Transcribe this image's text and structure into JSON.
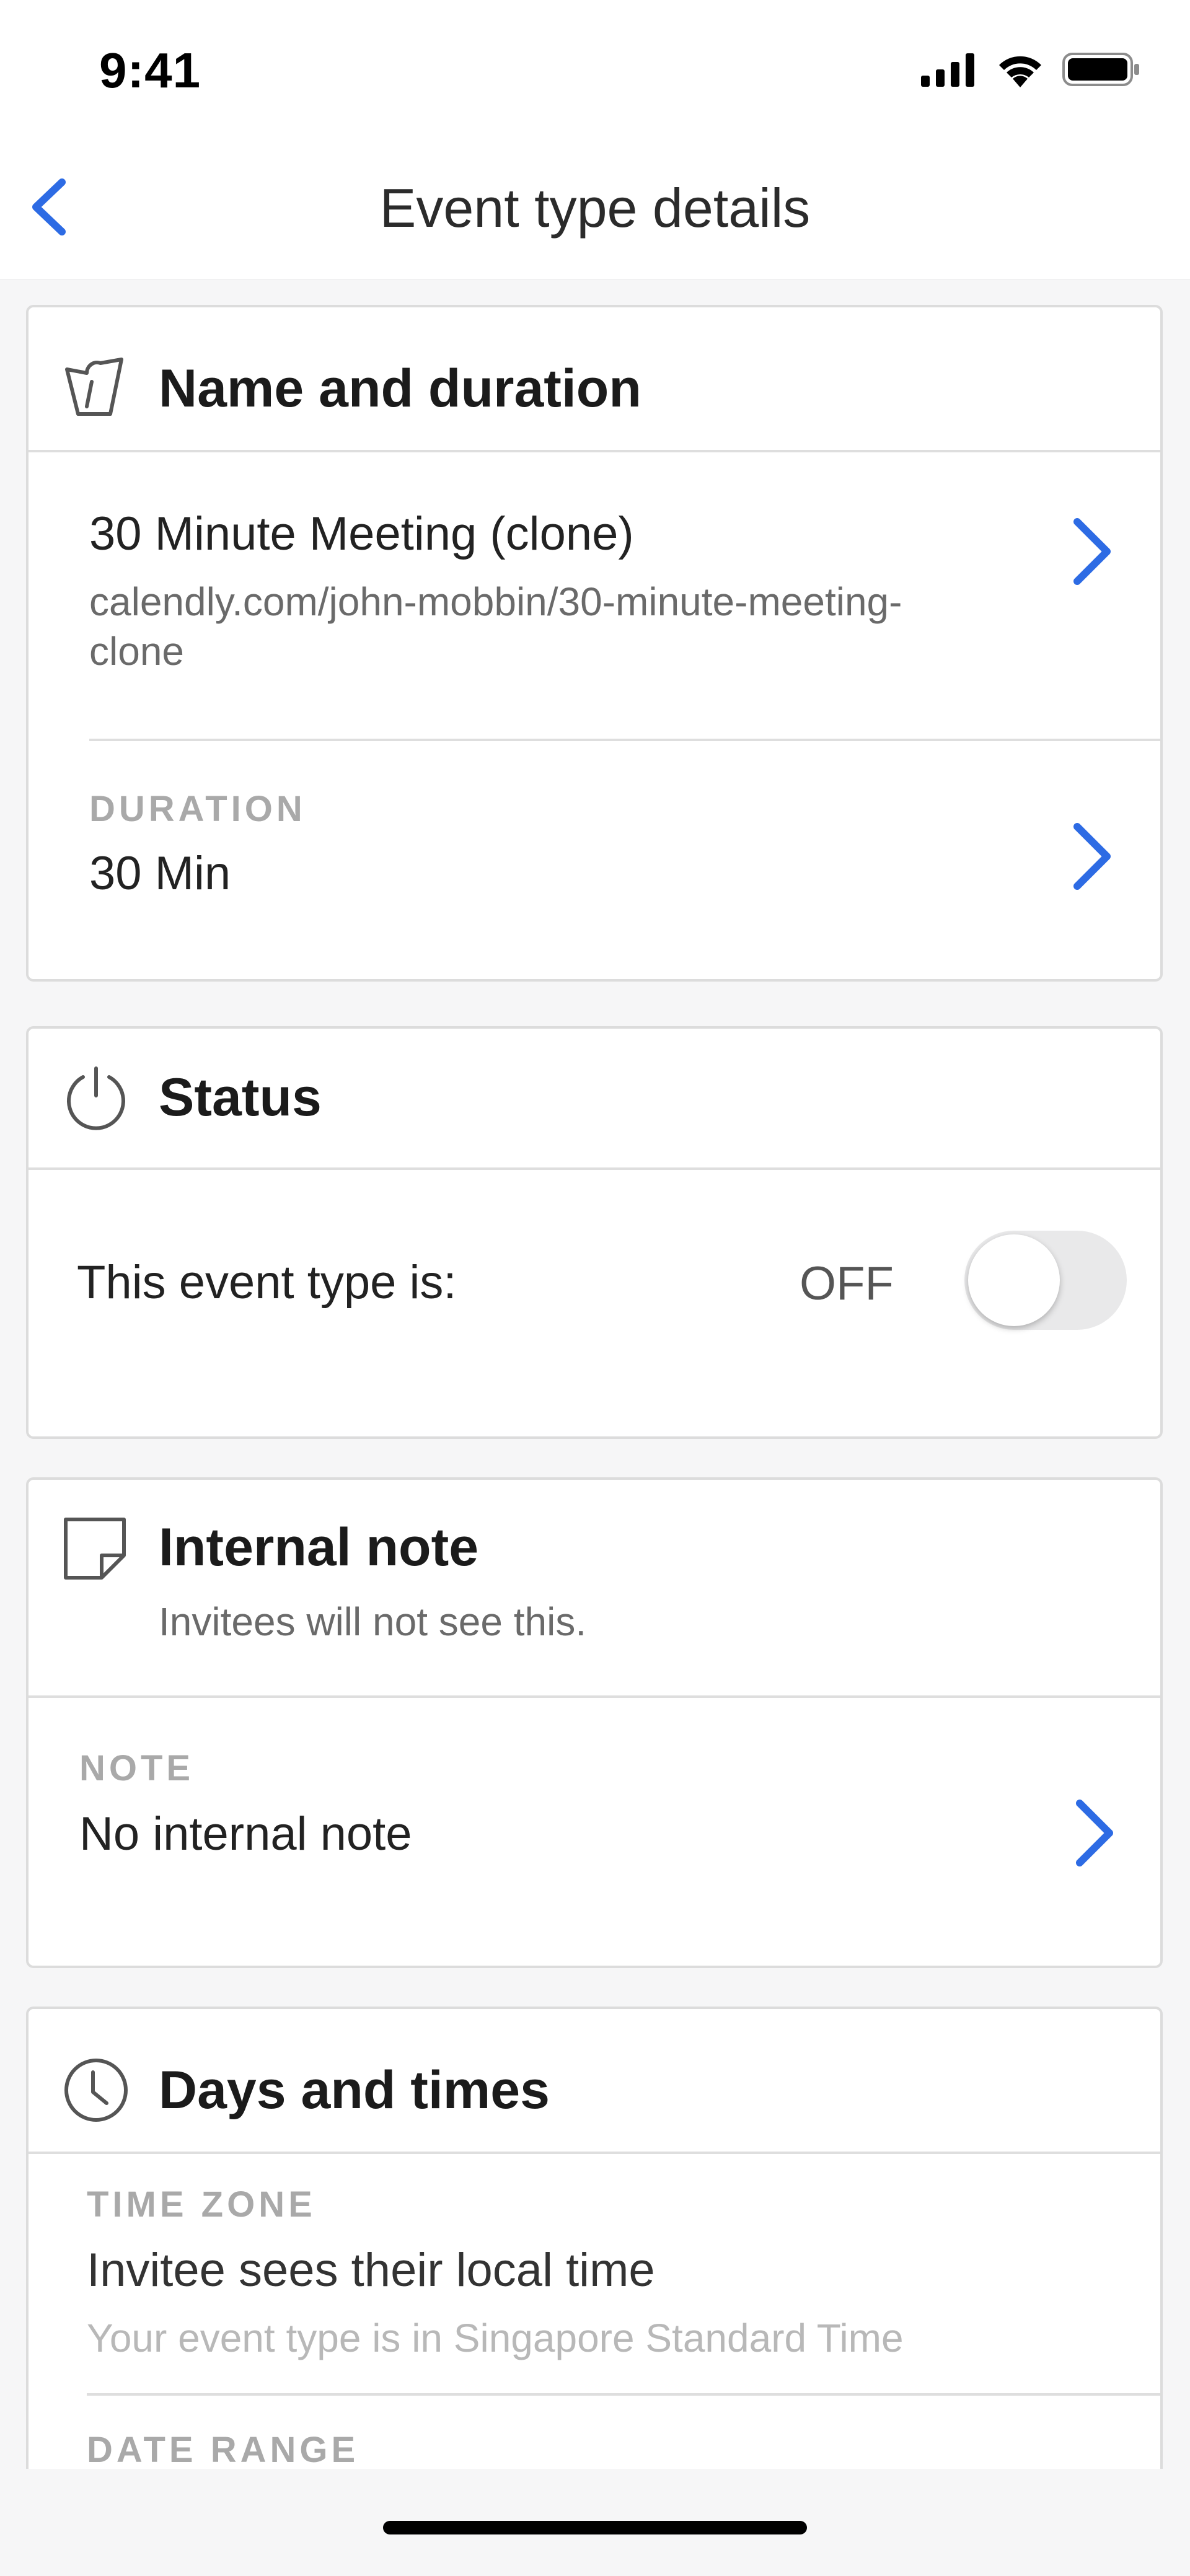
{
  "status_bar": {
    "time": "9:41"
  },
  "nav": {
    "title": "Event type details",
    "back_icon": "chevron-left-icon"
  },
  "name_duration": {
    "title": "Name and duration",
    "icon": "ticket-icon",
    "event_name": "30 Minute Meeting (clone)",
    "url_line1": "calendly.com/john-mobbin/30-minute-meeting-",
    "url_line2": "clone",
    "duration_label": "DURATION",
    "duration_value": "30 Min"
  },
  "status": {
    "title": "Status",
    "icon": "power-icon",
    "text": "This event type is:",
    "toggle_state": "OFF"
  },
  "internal_note": {
    "title": "Internal note",
    "subtitle": "Invitees will not see this.",
    "icon": "note-icon",
    "note_label": "NOTE",
    "note_value": "No internal note"
  },
  "days_times": {
    "title": "Days and times",
    "icon": "clock-icon",
    "timezone_label": "TIME ZONE",
    "timezone_value": "Invitee sees their local time",
    "timezone_sub": "Your event type is in Singapore Standard Time",
    "date_range_label": "DATE RANGE"
  },
  "colors": {
    "accent": "#2d6be4",
    "muted": "#a9a9a9",
    "divider": "#dedede"
  }
}
